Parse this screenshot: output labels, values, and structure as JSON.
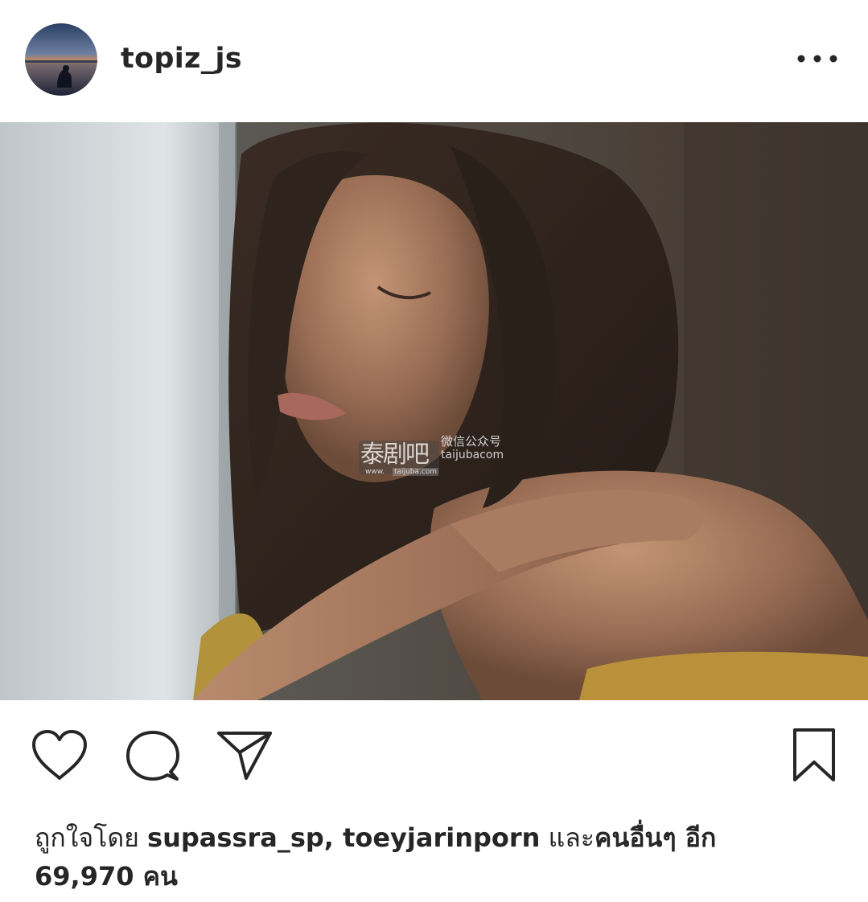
{
  "post": {
    "username": "topiz_js",
    "more_label": "•••",
    "watermark": {
      "big": "泰剧吧",
      "small_left": "www.",
      "small_right": "taijuba.com",
      "top": "微信公众号",
      "bottom": "taijubacom"
    },
    "likes": {
      "prefix": "ถูกใจโดย ",
      "user1": "supassra_sp",
      "separator": ", ",
      "user2": "toeyjarinporn",
      "middle": " และ",
      "others": "คนอื่นๆ อีก",
      "count": "69,970 คน"
    }
  },
  "icons": {
    "avatar": "sunset-avatar",
    "more": "more-dots-icon",
    "like": "heart-icon",
    "comment": "comment-bubble-icon",
    "share": "paper-plane-icon",
    "save": "bookmark-icon"
  },
  "colors": {
    "text": "#262626",
    "icon_stroke": "#262626",
    "background": "#ffffff"
  }
}
